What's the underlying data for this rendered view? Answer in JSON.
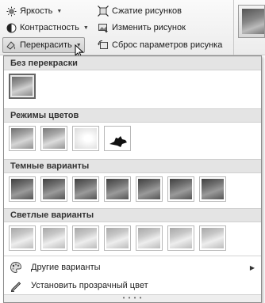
{
  "ribbon": {
    "brightness": "Яркость",
    "contrast": "Контрастность",
    "recolor": "Перекрасить",
    "compress": "Сжатие рисунков",
    "change": "Изменить рисунок",
    "reset": "Сброс параметров рисунка"
  },
  "panel": {
    "sections": [
      {
        "title": "Без перекраски"
      },
      {
        "title": "Режимы цветов"
      },
      {
        "title": "Темные варианты"
      },
      {
        "title": "Светлые варианты"
      }
    ],
    "more_variants": "Другие варианты",
    "set_transparent": "Установить прозрачный цвет",
    "grip": "• • • •"
  }
}
